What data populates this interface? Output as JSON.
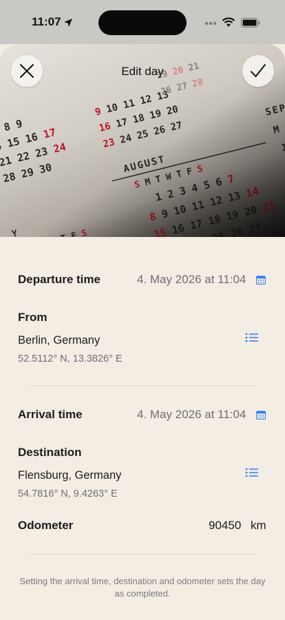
{
  "status": {
    "time": "11:07"
  },
  "nav": {
    "title": "Edit day"
  },
  "departure": {
    "label": "Departure time",
    "value": "4. May 2026 at 11:04"
  },
  "from": {
    "label": "From",
    "place": "Berlin, Germany",
    "coords": "52.5112° N, 13.3826° E"
  },
  "arrival": {
    "label": "Arrival time",
    "value": "4. May 2026 at 11:04"
  },
  "destination": {
    "label": "Destination",
    "place": "Flensburg, Germany",
    "coords": "54.7816° N, 9.4263° E"
  },
  "odometer": {
    "label": "Odometer",
    "value": "90450",
    "unit": "km"
  },
  "footer_note": "Setting the arrival time, destination and odometer sets the day as completed.",
  "colors": {
    "accent": "#2f7cf6",
    "background": "#f3ede4",
    "calendar_red": "#c0142b"
  }
}
